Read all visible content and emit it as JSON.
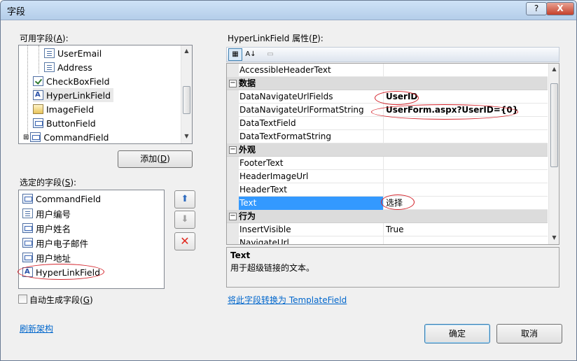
{
  "window": {
    "title": "字段",
    "help_label": "?",
    "close_label": "X"
  },
  "available": {
    "label": "可用字段(",
    "access_key": "A",
    "label_tail": "):",
    "items": [
      {
        "label": "UserEmail",
        "icon": "document-icon"
      },
      {
        "label": "Address",
        "icon": "document-icon"
      },
      {
        "label": "CheckBoxField",
        "icon": "checkbox-field-icon"
      },
      {
        "label": "HyperLinkField",
        "icon": "hyperlink-field-icon"
      },
      {
        "label": "ImageField",
        "icon": "image-field-icon"
      },
      {
        "label": "ButtonField",
        "icon": "button-field-icon"
      },
      {
        "label": "CommandField",
        "icon": "command-field-icon"
      }
    ],
    "expand_glyph": "⊞"
  },
  "add_button": {
    "label": "添加(",
    "access_key": "D",
    "tail": ")"
  },
  "selected": {
    "label": "选定的字段(",
    "access_key": "S",
    "label_tail": "):",
    "items": [
      {
        "label": "CommandField"
      },
      {
        "label": "用户编号"
      },
      {
        "label": "用户姓名"
      },
      {
        "label": "用户电子邮件"
      },
      {
        "label": "用户地址"
      },
      {
        "label": "HyperLinkField"
      }
    ]
  },
  "move_buttons": {
    "up": "⬆",
    "down": "⬇",
    "delete": "✕"
  },
  "auto_generate": {
    "label": "自动生成字段(",
    "access_key": "G",
    "tail": ")",
    "checked": false
  },
  "refresh_link": "刷新架构",
  "properties": {
    "label": "HyperLinkField 属性(",
    "access_key": "P",
    "label_tail": "):",
    "toolbar": {
      "categorized": "▦",
      "alpha": "A↓",
      "pages": "▭"
    },
    "rows": [
      {
        "type": "prop",
        "name": "AccessibleHeaderText",
        "value": ""
      },
      {
        "type": "cat",
        "name": "数据",
        "toggle": "−"
      },
      {
        "type": "prop",
        "name": "DataNavigateUrlFields",
        "value": "UserID"
      },
      {
        "type": "prop",
        "name": "DataNavigateUrlFormatString",
        "value": "UserForm.aspx?UserID={0}"
      },
      {
        "type": "prop",
        "name": "DataTextField",
        "value": ""
      },
      {
        "type": "prop",
        "name": "DataTextFormatString",
        "value": ""
      },
      {
        "type": "cat",
        "name": "外观",
        "toggle": "−"
      },
      {
        "type": "prop",
        "name": "FooterText",
        "value": ""
      },
      {
        "type": "prop",
        "name": "HeaderImageUrl",
        "value": ""
      },
      {
        "type": "prop",
        "name": "HeaderText",
        "value": ""
      },
      {
        "type": "prop",
        "name": "Text",
        "value": "选择"
      },
      {
        "type": "cat",
        "name": "行为",
        "toggle": "−"
      },
      {
        "type": "prop",
        "name": "InsertVisible",
        "value": "True"
      },
      {
        "type": "prop",
        "name": "NavigateUrl",
        "value": ""
      }
    ],
    "description_title": "Text",
    "description_text": "用于超级链接的文本。"
  },
  "convert_link": "将此字段转换为 TemplateField",
  "ok_button": "确定",
  "cancel_button": "取消",
  "colors": {
    "annotation": "#d3222a",
    "selection": "#3399ff",
    "link": "#0066cc"
  }
}
